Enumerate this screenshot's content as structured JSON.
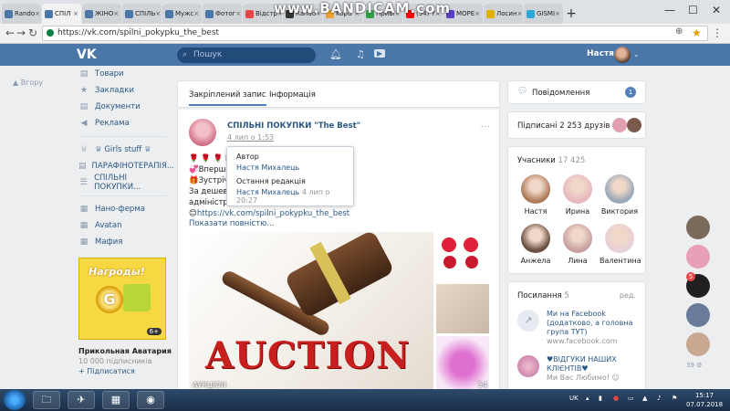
{
  "browser": {
    "tabs": [
      {
        "label": "Rando",
        "color": "#4a76a8",
        "active": false
      },
      {
        "label": "СПІЛ",
        "color": "#4a76a8",
        "active": true
      },
      {
        "label": "ЖІНО",
        "color": "#4a76a8",
        "active": false
      },
      {
        "label": "СПІЛЬ",
        "color": "#4a76a8",
        "active": false
      },
      {
        "label": "Мужс",
        "color": "#4a76a8",
        "active": false
      },
      {
        "label": "Фотог",
        "color": "#4a76a8",
        "active": false
      },
      {
        "label": "Відстр",
        "color": "#e64646",
        "active": false
      },
      {
        "label": "Rando",
        "color": "#333333",
        "active": false
      },
      {
        "label": "Kopu",
        "color": "#f0a030",
        "active": false
      },
      {
        "label": "Приві",
        "color": "#2ea043",
        "active": false
      },
      {
        "label": "(54) Y",
        "color": "#ff0000",
        "active": false
      },
      {
        "label": "МОРЕ",
        "color": "#5a3fc0",
        "active": false
      },
      {
        "label": "Лосин",
        "color": "#e0b000",
        "active": false
      },
      {
        "label": "GISMI",
        "color": "#2aa8d8",
        "active": false
      }
    ],
    "url": "https://vk.com/spilni_pokypku_the_best",
    "watermark": "www.BANDICAM.com"
  },
  "header": {
    "logo": "VK",
    "search_placeholder": "Пошук",
    "user_name": "Настя"
  },
  "leftnav": {
    "back": "Вгору",
    "items": [
      {
        "icon": "▤",
        "label": "Товари"
      },
      {
        "icon": "★",
        "label": "Закладки"
      },
      {
        "icon": "▤",
        "label": "Документи"
      },
      {
        "icon": "◀",
        "label": "Реклама"
      }
    ],
    "groups": [
      {
        "icon": "♕",
        "label": "♕ Girls stuff ♕"
      },
      {
        "icon": "▤",
        "label": "ПАРАФІНОТЕРАПІЯ..."
      },
      {
        "icon": "☰",
        "label": "СПІЛЬНІ ПОКУПКИ..."
      }
    ],
    "apps": [
      {
        "icon": "▦",
        "label": "Нано-ферма"
      },
      {
        "icon": "▦",
        "label": "Avatan"
      },
      {
        "icon": "▦",
        "label": "Мафия"
      }
    ],
    "ad": {
      "title": "Нагроды!",
      "coin": "G",
      "badge": "6+",
      "name": "Прикольная Аватария",
      "subscribers": "10 000 підписників",
      "follow": "+ Підписатися"
    }
  },
  "center": {
    "tabs": [
      "Закріплений запис",
      "Інформація"
    ],
    "post": {
      "author": "СПІЛЬНІ ПОКУПКИ \"The Best\"",
      "date": "4 лип о 1:53",
      "dots": "···",
      "lines": [
        "🌹 🌹 🌹 Ва                                      🌹",
        "💞Вперше                                    торів! 😊💐",
        "🎁Зустріча                                  🎁👠👜🎀🕶",
        "За дешеви                           екс😍крутий🐱аукціон 😊від",
        "адміністра"
      ],
      "link": "https://vk.com/spilni_pokypku_the_best",
      "show_more": "Показати повністю...",
      "image_text": "AUCTION",
      "image_caption": "АУКЦІОН",
      "more_count": "54"
    },
    "tooltip": {
      "author_label": "Автор",
      "author_name": "Настя Михалець",
      "edit_label": "Остання редакція",
      "edit_name": "Настя Михалець",
      "edit_time": "4 лип о 20:27"
    }
  },
  "right": {
    "notifications": {
      "label": "Повідомлення",
      "count": "1"
    },
    "friends": "Підписані 2 253 друзів",
    "members": {
      "title": "Учасники",
      "count": "17 425",
      "people": [
        {
          "name": "Настя",
          "color": "#b07a5a"
        },
        {
          "name": "Ирина",
          "color": "#e8b8c0"
        },
        {
          "name": "Виктория",
          "color": "#9aa8b8"
        },
        {
          "name": "Анжела",
          "color": "#6a5040"
        },
        {
          "name": "Лина",
          "color": "#c8a0a0"
        },
        {
          "name": "Валентина",
          "color": "#e8d0d8"
        }
      ]
    },
    "links": {
      "title": "Посилання",
      "count": "5",
      "edit": "ред.",
      "items": [
        {
          "title": "Ми на Facebook (додатково, а головна група ТУТ)",
          "url": "www.facebook.com"
        },
        {
          "title": "♥ВІДГУКИ НАШИХ КЛІЄНТІВ♥",
          "url": "Ми Вас Любимо! ☺"
        }
      ]
    }
  },
  "chats": {
    "badge": "5",
    "more": "39"
  },
  "taskbar": {
    "lang": "UK",
    "time": "15:17",
    "date": "07.07.2018"
  }
}
